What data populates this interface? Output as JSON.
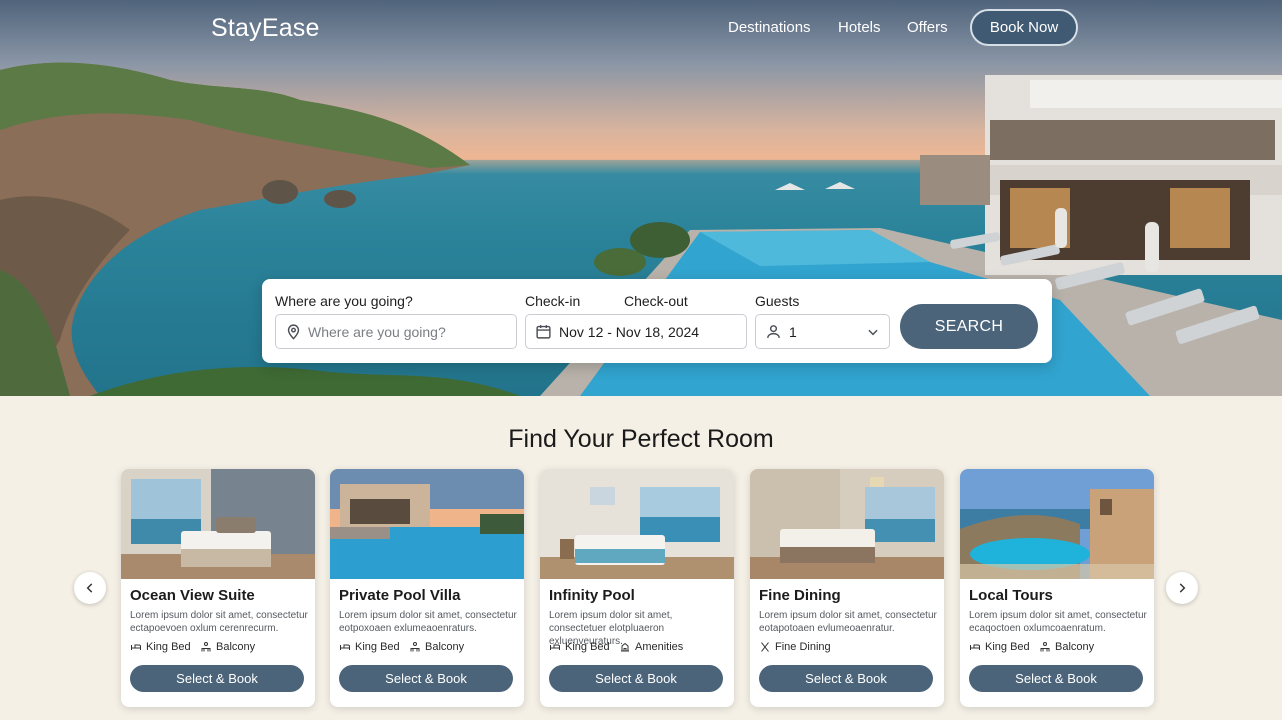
{
  "brand": "StayEase",
  "nav": {
    "links": [
      "Destinations",
      "Hotels",
      "Offers"
    ],
    "cta": "Book Now"
  },
  "search": {
    "destination_label": "Where are you going?",
    "destination_placeholder": "Where are you going?",
    "checkin_label": "Check-in",
    "checkout_label": "Check-out",
    "dates_value": "Nov 12 - Nov 18, 2024",
    "guests_label": "Guests",
    "guests_value": "1",
    "button": "SEARCH"
  },
  "section_title": "Find Your Perfect Room",
  "cards": [
    {
      "title": "Ocean View Suite",
      "desc": "Lorem ipsum dolor sit amet, consectetur ectapoevoen oxlum cerenrecurm.",
      "amenities": [
        "King Bed",
        "Balcony"
      ],
      "amenity_icons": [
        "bed-icon",
        "balcony-icon"
      ],
      "button": "Select & Book"
    },
    {
      "title": "Private Pool Villa",
      "desc": "Lorem ipsum dolor sit amet, consectetur eotpoxoaen exlumeaoenraturs.",
      "amenities": [
        "King Bed",
        "Balcony"
      ],
      "amenity_icons": [
        "bed-icon",
        "balcony-icon"
      ],
      "button": "Select & Book"
    },
    {
      "title": "Infinity Pool",
      "desc": "Lorem ipsum dolor sit amet, consectetuer elotpluaeron exluenveuraturs.",
      "amenities": [
        "King Bed",
        "Amenities"
      ],
      "amenity_icons": [
        "bed-icon",
        "amenities-icon"
      ],
      "button": "Select & Book"
    },
    {
      "title": "Fine Dining",
      "desc": "Lorem ipsum dolor sit amet, consectetur eotapotoaen evlumeoaenratur.",
      "amenities": [
        "Fine Dining"
      ],
      "amenity_icons": [
        "utensils-icon"
      ],
      "button": "Select & Book"
    },
    {
      "title": "Local Tours",
      "desc": "Lorem ipsum dolor sit amet, consectetur ecaqoctoen oxlumcoaenratum.",
      "amenities": [
        "King Bed",
        "Balcony"
      ],
      "amenity_icons": [
        "bed-icon",
        "balcony-icon"
      ],
      "button": "Select & Book"
    }
  ],
  "colors": {
    "accent": "#4b647a",
    "background": "#f4f0e6"
  }
}
